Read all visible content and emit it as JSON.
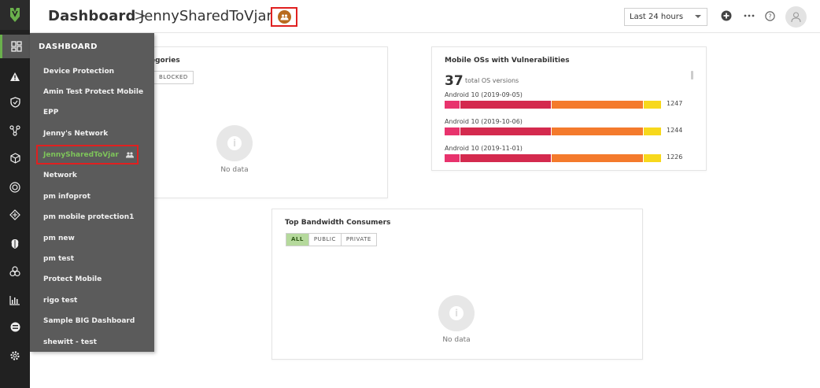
{
  "header": {
    "title": "Dashboard",
    "breadcrumb_sep": ">",
    "dashboard_name": "JennySharedToVjar",
    "time_range": "Last 24 hours"
  },
  "menu": {
    "heading": "DASHBOARD",
    "items": [
      {
        "label": "Device Protection"
      },
      {
        "label": "Amin Test Protect Mobile"
      },
      {
        "label": "EPP"
      },
      {
        "label": "Jenny's Network"
      },
      {
        "label": "JennySharedToVjar",
        "selected": true
      },
      {
        "label": "Network"
      },
      {
        "label": "pm infoprot"
      },
      {
        "label": "pm mobile protection1"
      },
      {
        "label": "pm new"
      },
      {
        "label": "pm test"
      },
      {
        "label": "Protect Mobile"
      },
      {
        "label": "rigo test"
      },
      {
        "label": "Sample BIG Dashboard"
      },
      {
        "label": "shewitt - test"
      }
    ]
  },
  "cards": {
    "categories": {
      "title_fragment": "egories",
      "filter_visible": "BLOCKED",
      "empty": "No data"
    },
    "mobile_os": {
      "title": "Mobile OSs with Vulnerabilities",
      "count": "37",
      "count_label": "total OS versions",
      "rows": [
        {
          "name": "Android 10 (2019-09-05)",
          "value": "1247"
        },
        {
          "name": "Android 10 (2019-10-06)",
          "value": "1244"
        },
        {
          "name": "Android 10 (2019-11-01)",
          "value": "1226"
        }
      ],
      "colors": {
        "critical": "#e8336d",
        "high": "#d42a4e",
        "medium": "#f47a2c",
        "low": "#f7d81c"
      }
    },
    "bandwidth": {
      "title": "Top Bandwidth Consumers",
      "filters": [
        "ALL",
        "PUBLIC",
        "PRIVATE"
      ],
      "active_filter": "ALL",
      "empty": "No data"
    }
  },
  "colors": {
    "rail": "#212121",
    "menu": "#5b5b5b",
    "accent_green": "#6ab04c",
    "highlight_red": "#e02020",
    "shared_badge": "#b86b1f"
  }
}
